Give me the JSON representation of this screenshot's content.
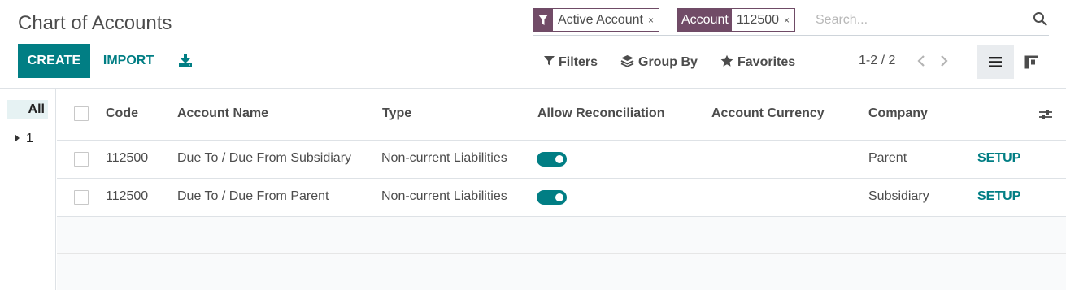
{
  "header": {
    "title": "Chart of Accounts",
    "create_label": "CREATE",
    "import_label": "IMPORT",
    "download_icon": "download-icon"
  },
  "search": {
    "facets": [
      {
        "label_icon": "filter-icon",
        "value": "Active Account",
        "remove": "×"
      },
      {
        "label": "Account",
        "value": "112500",
        "remove": "×"
      }
    ],
    "placeholder": "Search...",
    "search_icon": "magnifier-icon"
  },
  "toolbar": {
    "filters_label": "Filters",
    "groupby_label": "Group By",
    "favorites_label": "Favorites",
    "pager": "1-2 / 2"
  },
  "side_panel": {
    "items": [
      {
        "label": "All",
        "active": true
      },
      {
        "label": "1",
        "expandable": true
      }
    ]
  },
  "table": {
    "columns": [
      "Code",
      "Account Name",
      "Type",
      "Allow Reconciliation",
      "Account Currency",
      "Company"
    ],
    "rows": [
      {
        "code": "112500",
        "name": "Due To / Due From Subsidiary",
        "type": "Non-current Liabilities",
        "reconcile": true,
        "currency": "",
        "company": "Parent",
        "action": "SETUP"
      },
      {
        "code": "112500",
        "name": "Due To / Due From Parent",
        "type": "Non-current Liabilities",
        "reconcile": true,
        "currency": "",
        "company": "Subsidiary",
        "action": "SETUP"
      }
    ]
  },
  "colors": {
    "primary": "#017e84",
    "facet": "#714b67",
    "text": "#4c4c4c"
  }
}
